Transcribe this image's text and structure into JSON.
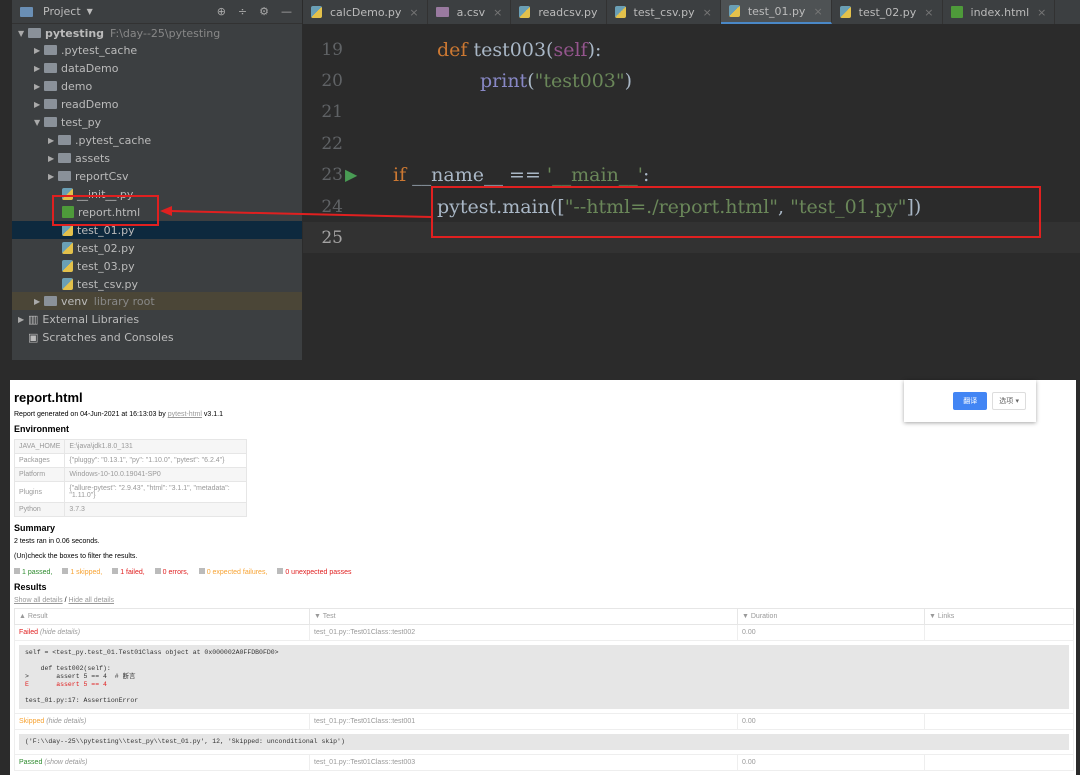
{
  "sidebar": {
    "title": "Project",
    "root": "pytesting",
    "root_path": "F:\\day--25\\pytesting",
    "items": [
      ".pytest_cache",
      "dataDemo",
      "demo",
      "readDemo",
      "test_py",
      ".pytest_cache",
      "assets",
      "reportCsv",
      "__init__.py",
      "report.html",
      "test_01.py",
      "test_02.py",
      "test_03.py",
      "test_csv.py",
      "venv",
      "library root",
      "External Libraries",
      "Scratches and Consoles"
    ]
  },
  "tabs": [
    "calcDemo.py",
    "a.csv",
    "readcsv.py",
    "test_csv.py",
    "test_01.py",
    "test_02.py",
    "index.html"
  ],
  "editor": {
    "line_numbers": [
      "19",
      "20",
      "21",
      "22",
      "23",
      "24",
      "25"
    ],
    "l19_kw": "def",
    "l19_name": "test003",
    "l19_self": "self",
    "l20_print": "print",
    "l20_str": "\"test003\"",
    "l23_if": "if",
    "l23_name": "__name__",
    "l23_eq": "==",
    "l23_main": "'__main__'",
    "l24_call": "pytest.main([",
    "l24_s1": "\"--html=./report.html\"",
    "l24_s2": "\"test_01.py\"",
    "l24_end": "])"
  },
  "report": {
    "title": "report.html",
    "generated": "Report generated on 04-Jun-2021 at 16:13:03 by",
    "generator_link": "pytest-html",
    "version": "v3.1.1",
    "env_title": "Environment",
    "env": [
      [
        "JAVA_HOME",
        "E:\\java\\jdk1.8.0_131"
      ],
      [
        "Packages",
        "{\"pluggy\": \"0.13.1\", \"py\": \"1.10.0\", \"pytest\": \"6.2.4\"}"
      ],
      [
        "Platform",
        "Windows-10-10.0.19041-SP0"
      ],
      [
        "Plugins",
        "{\"allure-pytest\": \"2.9.43\", \"html\": \"3.1.1\", \"metadata\": \"1.11.0\"}"
      ],
      [
        "Python",
        "3.7.3"
      ]
    ],
    "summary_title": "Summary",
    "summary": "2 tests ran in 0.06 seconds.",
    "filter_hint": "(Un)check the boxes to filter the results.",
    "filters": [
      "1 passed,",
      "1 skipped,",
      "1 failed,",
      "0 errors,",
      "0 expected failures,",
      "0 unexpected passes"
    ],
    "results_title": "Results",
    "show_all": "Show all details",
    "sep": "/",
    "hide_all": "Hide all details",
    "columns": [
      "Result",
      "Test",
      "Duration",
      "Links"
    ],
    "rows": [
      {
        "result": "Failed",
        "toggle": "(hide details)",
        "test": "test_01.py::Test01Class::test002",
        "duration": "0.00",
        "log": [
          "self = <test_py.test_01.Test01Class object at 0x000002A0FFDB0FD0>",
          "",
          "    def test002(self):",
          ">       assert 5 == 4  # 断言",
          "E       assert 5 == 4",
          "",
          "test_01.py:17: AssertionError"
        ]
      },
      {
        "result": "Skipped",
        "toggle": "(hide details)",
        "test": "test_01.py::Test01Class::test001",
        "duration": "0.00",
        "log": [
          "('F:\\\\day--25\\\\pytesting\\\\test_py\\\\test_01.py', 12, 'Skipped: unconditional skip')"
        ]
      },
      {
        "result": "Passed",
        "toggle": "(show details)",
        "test": "test_01.py::Test01Class::test003",
        "duration": "0.00"
      }
    ]
  },
  "translate": {
    "translate": "翻译",
    "options": "选项"
  }
}
